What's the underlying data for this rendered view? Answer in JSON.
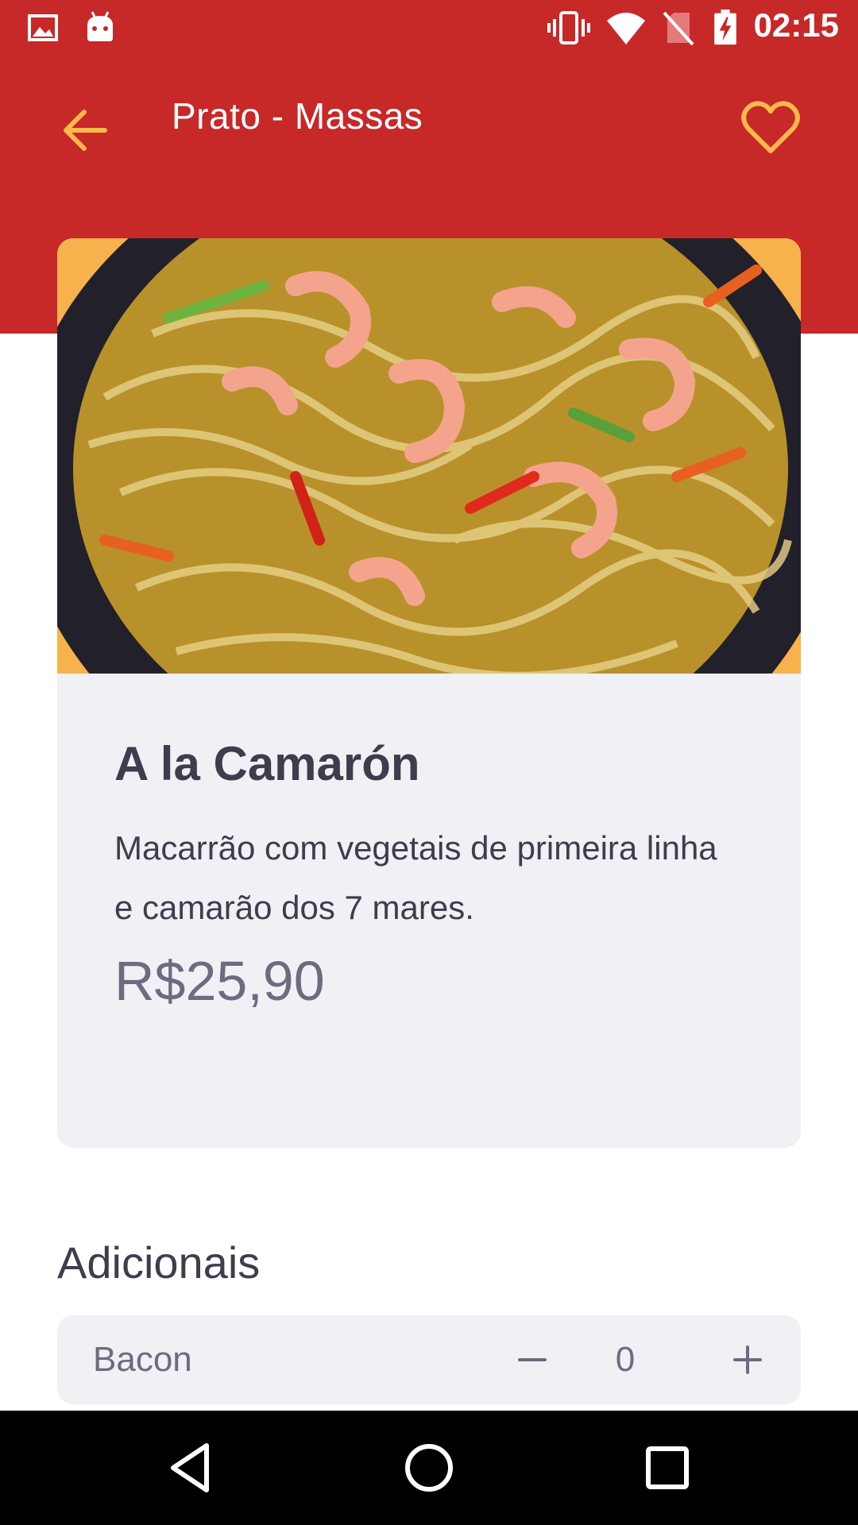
{
  "status_bar": {
    "time": "02:15",
    "icons": [
      "gallery-icon",
      "android-icon",
      "vibrate-icon",
      "wifi-icon",
      "no-sim-icon",
      "battery-charging-icon"
    ]
  },
  "header": {
    "title": "Prato - Massas",
    "back_icon": "arrow-left-icon",
    "favorite_icon": "heart-outline-icon",
    "accent_color": "#ffb84d",
    "background_color": "#c72828"
  },
  "dish": {
    "name": "A la Camarón",
    "description": "Macarrão com vegetais de primeira linha e camarão dos 7 mares.",
    "price": "R$25,90"
  },
  "extras": {
    "title": "Adicionais",
    "items": [
      {
        "name": "Bacon",
        "quantity": "0"
      }
    ]
  },
  "nav_bar": {
    "buttons": [
      "back-triangle-icon",
      "home-circle-icon",
      "recents-square-icon"
    ]
  }
}
